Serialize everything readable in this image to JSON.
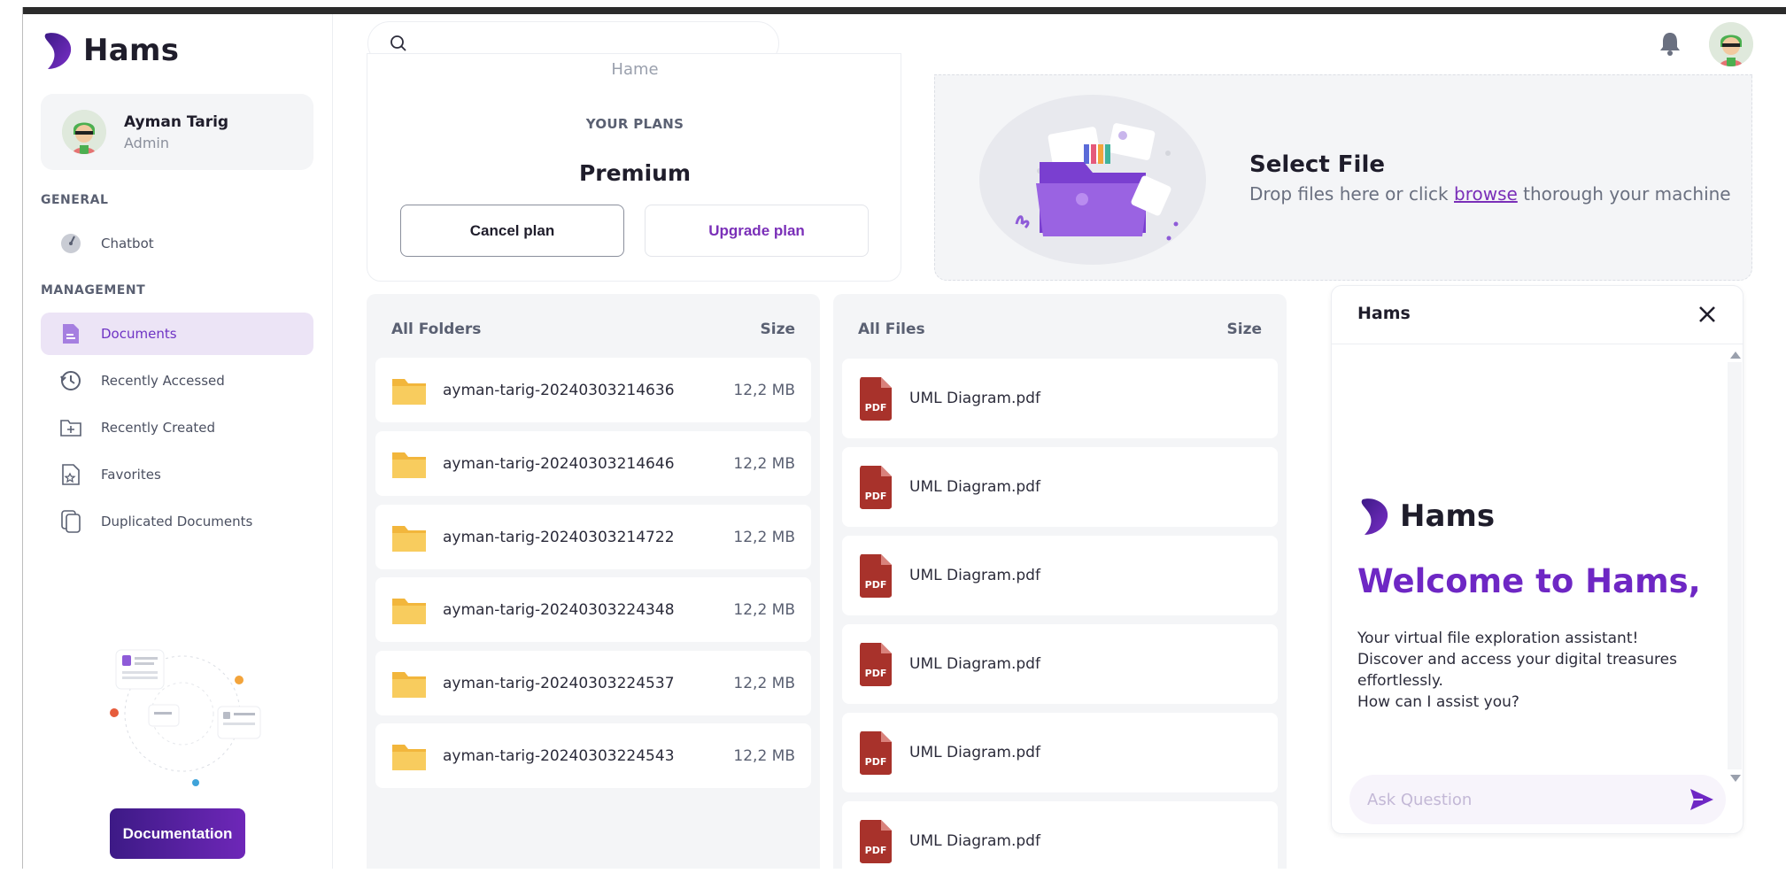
{
  "app": {
    "name": "Hams"
  },
  "user": {
    "name": "Ayman Tarig",
    "role": "Admin"
  },
  "sidebar": {
    "sections": [
      {
        "title": "GENERAL",
        "items": [
          {
            "label": "Chatbot",
            "icon": "gauge-icon"
          }
        ]
      },
      {
        "title": "MANAGEMENT",
        "items": [
          {
            "label": "Documents",
            "icon": "document-icon",
            "active": true
          },
          {
            "label": "Recently Accessed",
            "icon": "history-icon"
          },
          {
            "label": "Recently Created",
            "icon": "folder-plus-icon"
          },
          {
            "label": "Favorites",
            "icon": "favorite-file-icon"
          },
          {
            "label": "Duplicated Documents",
            "icon": "copy-icon"
          }
        ]
      }
    ],
    "documentation_button": "Documentation"
  },
  "header": {
    "search_placeholder": ""
  },
  "plans": {
    "cut_text": "Hame",
    "label": "YOUR PLANS",
    "current": "Premium",
    "cancel_label": "Cancel plan",
    "upgrade_label": "Upgrade plan"
  },
  "upload": {
    "title": "Select File",
    "text_before": "Drop files here or click ",
    "link": "browse",
    "text_after": " thorough your machine"
  },
  "folders": {
    "header_name": "All Folders",
    "header_size": "Size",
    "items": [
      {
        "name": "ayman-tarig-20240303214636",
        "size": "12,2 MB"
      },
      {
        "name": "ayman-tarig-20240303214646",
        "size": "12,2 MB"
      },
      {
        "name": "ayman-tarig-20240303214722",
        "size": "12,2 MB"
      },
      {
        "name": "ayman-tarig-20240303224348",
        "size": "12,2 MB"
      },
      {
        "name": "ayman-tarig-20240303224537",
        "size": "12,2 MB"
      },
      {
        "name": "ayman-tarig-20240303224543",
        "size": "12,2 MB"
      }
    ]
  },
  "files": {
    "header_name": "All Files",
    "header_size": "Size",
    "items": [
      {
        "name": "UML Diagram.pdf",
        "badge": "PDF"
      },
      {
        "name": "UML Diagram.pdf",
        "badge": "PDF"
      },
      {
        "name": "UML Diagram.pdf",
        "badge": "PDF"
      },
      {
        "name": "UML Diagram.pdf",
        "badge": "PDF"
      },
      {
        "name": "UML Diagram.pdf",
        "badge": "PDF"
      },
      {
        "name": "UML Diagram.pdf",
        "badge": "PDF"
      }
    ]
  },
  "chat": {
    "title": "Hams",
    "logo_text": "Hams",
    "welcome": "Welcome to Hams,",
    "message_lines": [
      "Your virtual file exploration assistant!",
      "Discover and access your digital treasures",
      "effortlessly.",
      "How can I assist you?"
    ],
    "input_placeholder": "Ask Question"
  },
  "colors": {
    "accent": "#6e27c4",
    "active_bg": "#ece4f6",
    "pdf": "#a8322b",
    "folder": "#f7c54d"
  }
}
